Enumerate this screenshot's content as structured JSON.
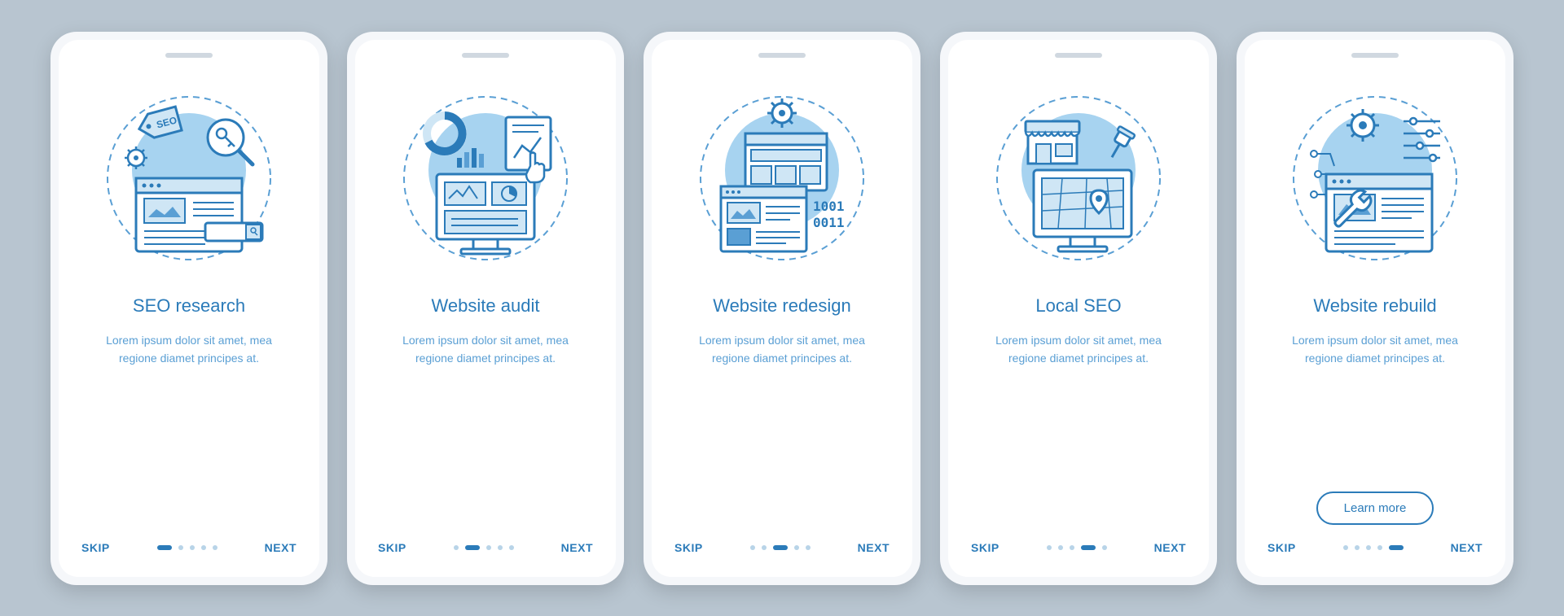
{
  "common": {
    "skip": "SKIP",
    "next": "NEXT",
    "learn_more": "Learn more",
    "description": "Lorem ipsum dolor sit amet, mea regione diamet principes at."
  },
  "colors": {
    "primary": "#2b7bb9",
    "secondary": "#5a9fd4",
    "accent_fill": "#a7d3f0",
    "background": "#b8c5d0",
    "phone_bezel": "#f5f7fa"
  },
  "screens": [
    {
      "title": "SEO research",
      "icon": "seo-research-icon",
      "active_dot": 0,
      "has_learn_more": false
    },
    {
      "title": "Website audit",
      "icon": "website-audit-icon",
      "active_dot": 1,
      "has_learn_more": false
    },
    {
      "title": "Website redesign",
      "icon": "website-redesign-icon",
      "active_dot": 2,
      "has_learn_more": false
    },
    {
      "title": "Local SEO",
      "icon": "local-seo-icon",
      "active_dot": 3,
      "has_learn_more": false
    },
    {
      "title": "Website rebuild",
      "icon": "website-rebuild-icon",
      "active_dot": 4,
      "has_learn_more": true
    }
  ],
  "icon_details": {
    "seo-research-icon": [
      "seo-tag",
      "gear",
      "magnifying-glass",
      "key",
      "browser-window",
      "search-bar"
    ],
    "website-audit-icon": [
      "donut-chart",
      "bar-chart",
      "document-chart",
      "pointer-hand",
      "monitor",
      "analytics-panels"
    ],
    "website-redesign-icon": [
      "gear",
      "browser-layout",
      "browser-content",
      "binary-code-1001-0011"
    ],
    "local-seo-icon": [
      "storefront",
      "pushpin",
      "monitor",
      "map-grid",
      "location-pin"
    ],
    "website-rebuild-icon": [
      "gear",
      "sliders",
      "network-nodes",
      "browser-window",
      "wrench"
    ]
  }
}
